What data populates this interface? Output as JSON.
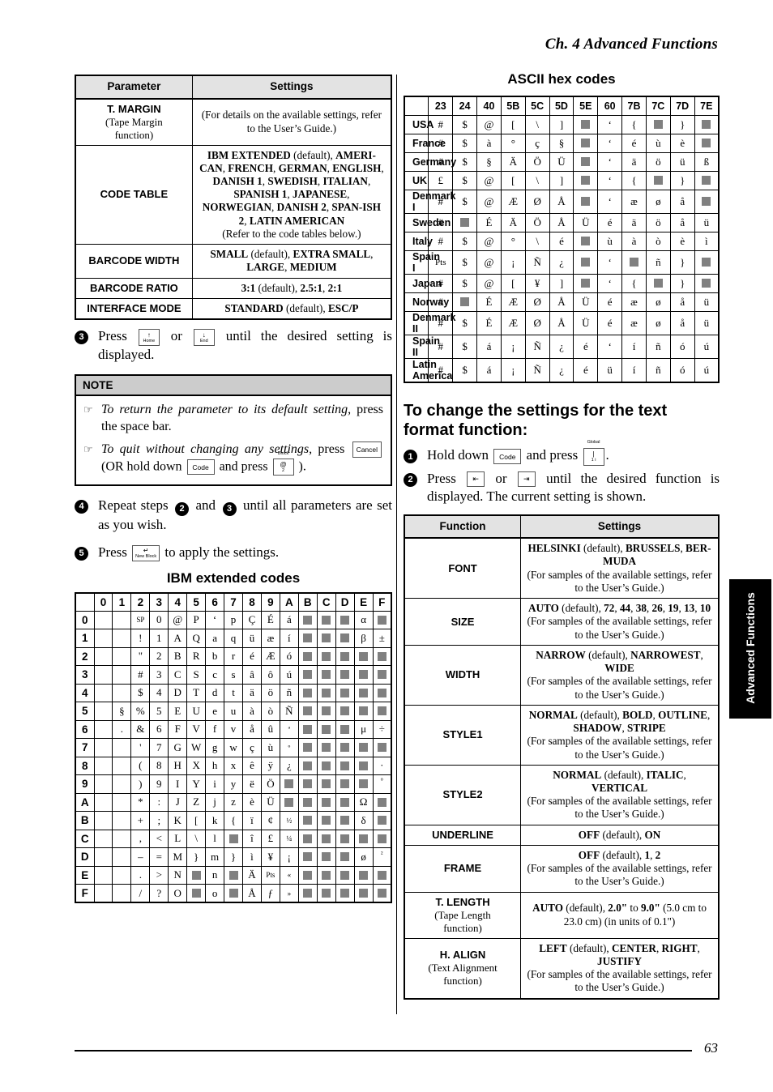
{
  "header": {
    "running_head": "Ch. 4 Advanced Functions"
  },
  "footer": {
    "page_number": "63"
  },
  "side_tab": {
    "label": "Advanced Functions"
  },
  "param_table": {
    "columns": [
      "Parameter",
      "Settings"
    ],
    "rows": [
      {
        "name": "T. MARGIN",
        "sub": "(Tape Margin function)",
        "settings_html": "(For details on the available settings, refer to the User’s Guide.)"
      },
      {
        "name": "CODE TABLE",
        "sub": "",
        "settings_html": "<b>IBM EXTENDED</b> (default), <b>AMERI-CAN</b>, <b>FRENCH</b>, <b>GERMAN</b>, <b>ENGLISH</b>, <b>DANISH 1</b>, <b>SWEDISH</b>, <b>ITALIAN</b>, <b>SPANISH 1</b>, <b>JAPANESE</b>, <b>NORWEGIAN</b>, <b>DANISH 2</b>, <b>SPAN-ISH 2</b>, <b>LATIN AMERICAN</b><br>(Refer to the code tables below.)"
      },
      {
        "name": "BARCODE WIDTH",
        "sub": "",
        "settings_html": "<b>SMALL</b> (default), <b>EXTRA SMALL</b>, <b>LARGE</b>, <b>MEDIUM</b>"
      },
      {
        "name": "BARCODE RATIO",
        "sub": "",
        "settings_html": "<b>3:1</b> (default), <b>2.5:1</b>, <b>2:1</b>"
      },
      {
        "name": "INTERFACE MODE",
        "sub": "",
        "settings_html": "<b>STANDARD</b> (default), <b>ESC/P</b>"
      }
    ]
  },
  "step3": {
    "num": "3",
    "text_before": "Press",
    "key_home": {
      "top": "↑",
      "bottom": "Home"
    },
    "text_or": "or",
    "key_end": {
      "top": "↓",
      "bottom": "End"
    },
    "text_after": "until the desired setting is displayed."
  },
  "note": {
    "title": "NOTE",
    "hand_icon": "☞",
    "item1_html": "<i>To return the parameter to its default setting,</i> press the space bar.",
    "item2_before": "To quit without changing any settings,",
    "item2_press": "press",
    "key_cancel": "Cancel",
    "item2_mid": "(OR hold down",
    "key_code": "Code",
    "item2_and": "and press",
    "key_block": {
      "cap": "Block",
      "top": "@",
      "bottom": "2"
    },
    "item2_end": ")."
  },
  "step4": {
    "num": "4",
    "text_before": "Repeat steps",
    "inline_a": "2",
    "text_and": "and",
    "inline_b": "3",
    "text_after": "until all parameters are set as you wish."
  },
  "step5": {
    "num": "5",
    "text_before": "Press",
    "key_newblock": {
      "top": "↵",
      "bottom": "New Block"
    },
    "text_after": "to apply the settings."
  },
  "ibm_table": {
    "title": "IBM extended codes",
    "columns": [
      "",
      "0",
      "1",
      "2",
      "3",
      "4",
      "5",
      "6",
      "7",
      "8",
      "9",
      "A",
      "B",
      "C",
      "D",
      "E",
      "F"
    ],
    "rows": [
      {
        "label": "0",
        "cells": [
          "",
          "",
          "SP",
          "0",
          "@",
          "P",
          "‘",
          "p",
          "Ç",
          "É",
          "á",
          "■",
          "■",
          "■",
          "α",
          "■"
        ]
      },
      {
        "label": "1",
        "cells": [
          "",
          "",
          "!",
          "1",
          "A",
          "Q",
          "a",
          "q",
          "ü",
          "æ",
          "í",
          "■",
          "■",
          "■",
          "β",
          "±"
        ]
      },
      {
        "label": "2",
        "cells": [
          "",
          "",
          "\"",
          "2",
          "B",
          "R",
          "b",
          "r",
          "é",
          "Æ",
          "ó",
          "■",
          "■",
          "■",
          "■",
          "■"
        ]
      },
      {
        "label": "3",
        "cells": [
          "",
          "",
          "#",
          "3",
          "C",
          "S",
          "c",
          "s",
          "â",
          "ô",
          "ú",
          "■",
          "■",
          "■",
          "■",
          "■"
        ]
      },
      {
        "label": "4",
        "cells": [
          "",
          "",
          "$",
          "4",
          "D",
          "T",
          "d",
          "t",
          "ä",
          "ö",
          "ñ",
          "■",
          "■",
          "■",
          "■",
          "■"
        ]
      },
      {
        "label": "5",
        "cells": [
          "",
          "§",
          "%",
          "5",
          "E",
          "U",
          "e",
          "u",
          "à",
          "ò",
          "Ñ",
          "■",
          "■",
          "■",
          "■",
          "■"
        ]
      },
      {
        "label": "6",
        "cells": [
          "",
          ".",
          "&",
          "6",
          "F",
          "V",
          "f",
          "v",
          "å",
          "û",
          "ª",
          "■",
          "■",
          "■",
          "μ",
          "÷"
        ]
      },
      {
        "label": "7",
        "cells": [
          "",
          "",
          "'",
          "7",
          "G",
          "W",
          "g",
          "w",
          "ç",
          "ù",
          "º",
          "■",
          "■",
          "■",
          "■",
          "■"
        ]
      },
      {
        "label": "8",
        "cells": [
          "",
          "",
          "(",
          "8",
          "H",
          "X",
          "h",
          "x",
          "ê",
          "ÿ",
          "¿",
          "■",
          "■",
          "■",
          "■",
          "·"
        ]
      },
      {
        "label": "9",
        "cells": [
          "",
          "",
          ")",
          "9",
          "I",
          "Y",
          "i",
          "y",
          "ë",
          "Ö",
          "■",
          "■",
          "■",
          "■",
          "■",
          "°"
        ]
      },
      {
        "label": "A",
        "cells": [
          "",
          "",
          "*",
          ":",
          "J",
          "Z",
          "j",
          "z",
          "è",
          "Ü",
          "■",
          "■",
          "■",
          "■",
          "Ω",
          "■"
        ]
      },
      {
        "label": "B",
        "cells": [
          "",
          "",
          "+",
          ";",
          "K",
          "[",
          "k",
          "{",
          "ï",
          "¢",
          "½",
          "■",
          "■",
          "■",
          "δ",
          "■"
        ]
      },
      {
        "label": "C",
        "cells": [
          "",
          "",
          ",",
          "<",
          "L",
          "\\",
          "l",
          "■",
          "î",
          "£",
          "¼",
          "■",
          "■",
          "■",
          "■",
          "■"
        ]
      },
      {
        "label": "D",
        "cells": [
          "",
          "",
          "–",
          "=",
          "M",
          "}",
          "m",
          "}",
          "ì",
          "¥",
          "¡",
          "■",
          "■",
          "■",
          "ø",
          "²"
        ]
      },
      {
        "label": "E",
        "cells": [
          "",
          "",
          ".",
          ">",
          "N",
          "■",
          "n",
          "■",
          "Ä",
          "Pts",
          "«",
          "■",
          "■",
          "■",
          "■",
          "■"
        ]
      },
      {
        "label": "F",
        "cells": [
          "",
          "",
          "/",
          "?",
          "O",
          "■",
          "o",
          "■",
          "Å",
          "ƒ",
          "»",
          "■",
          "■",
          "■",
          "■",
          "■"
        ]
      }
    ]
  },
  "ascii_table": {
    "title": "ASCII hex codes",
    "columns": [
      "",
      "23",
      "24",
      "40",
      "5B",
      "5C",
      "5D",
      "5E",
      "60",
      "7B",
      "7C",
      "7D",
      "7E"
    ],
    "rows": [
      {
        "label": "USA",
        "cells": [
          "#",
          "$",
          "@",
          "[",
          "\\",
          "]",
          "■",
          "‘",
          "{",
          "■",
          "}",
          "■"
        ]
      },
      {
        "label": "France",
        "cells": [
          "#",
          "$",
          "à",
          "°",
          "ç",
          "§",
          "■",
          "‘",
          "é",
          "ù",
          "è",
          "■"
        ]
      },
      {
        "label": "Germany",
        "cells": [
          "#",
          "$",
          "§",
          "Ä",
          "Ö",
          "Ü",
          "■",
          "‘",
          "ä",
          "ö",
          "ü",
          "ß"
        ]
      },
      {
        "label": "UK",
        "cells": [
          "£",
          "$",
          "@",
          "[",
          "\\",
          "]",
          "■",
          "‘",
          "{",
          "■",
          "}",
          "■"
        ]
      },
      {
        "label": "Denmark I",
        "cells": [
          "#",
          "$",
          "@",
          "Æ",
          "Ø",
          "Å",
          "■",
          "‘",
          "æ",
          "ø",
          "å",
          "■"
        ]
      },
      {
        "label": "Sweden",
        "cells": [
          "#",
          "■",
          "É",
          "Ä",
          "Ö",
          "Å",
          "Ü",
          "é",
          "ä",
          "ö",
          "å",
          "ü"
        ]
      },
      {
        "label": "Italy",
        "cells": [
          "#",
          "$",
          "@",
          "°",
          "\\",
          "é",
          "■",
          "ù",
          "à",
          "ò",
          "è",
          "ì"
        ]
      },
      {
        "label": "Spain I",
        "cells": [
          "Pts",
          "$",
          "@",
          "¡",
          "Ñ",
          "¿",
          "■",
          "‘",
          "■",
          "ñ",
          "}",
          "■"
        ]
      },
      {
        "label": "Japan",
        "cells": [
          "#",
          "$",
          "@",
          "[",
          "¥",
          "]",
          "■",
          "‘",
          "{",
          "■",
          "}",
          "■"
        ]
      },
      {
        "label": "Norway",
        "cells": [
          "#",
          "■",
          "É",
          "Æ",
          "Ø",
          "Å",
          "Ü",
          "é",
          "æ",
          "ø",
          "å",
          "ü"
        ]
      },
      {
        "label": "Denmark II",
        "cells": [
          "#",
          "$",
          "É",
          "Æ",
          "Ø",
          "Å",
          "Ü",
          "é",
          "æ",
          "ø",
          "å",
          "ü"
        ]
      },
      {
        "label": "Spain II",
        "cells": [
          "#",
          "$",
          "á",
          "¡",
          "Ñ",
          "¿",
          "é",
          "‘",
          "í",
          "ñ",
          "ó",
          "ú"
        ]
      },
      {
        "label": "Latin America",
        "cells": [
          "#",
          "$",
          "á",
          "¡",
          "Ñ",
          "¿",
          "é",
          "ü",
          "í",
          "ñ",
          "ó",
          "ú"
        ]
      }
    ]
  },
  "textformat": {
    "heading": "To change the settings for the text format function:",
    "step1": {
      "num": "1",
      "text_before": "Hold down",
      "key_code": "Code",
      "text_mid": "and press",
      "key_global": {
        "cap": "Global",
        "top": "|",
        "bottom": "1  i"
      },
      "text_after": "."
    },
    "step2": {
      "num": "2",
      "text_before": "Press",
      "key_left": "⇤",
      "text_or": "or",
      "key_right": "⇥",
      "text_after": "until the desired function is displayed. The current setting is shown."
    }
  },
  "function_table": {
    "columns": [
      "Function",
      "Settings"
    ],
    "rows": [
      {
        "name": "FONT",
        "sub": "",
        "settings_html": "<b>HELSINKI</b> (default), <b>BRUSSELS</b>, <b>BER-MUDA</b><br>(For samples of the available settings, refer to the User’s Guide.)"
      },
      {
        "name": "SIZE",
        "sub": "",
        "settings_html": "<b>AUTO</b> (default), <b>72</b>, <b>44</b>, <b>38</b>, <b>26</b>, <b>19</b>, <b>13</b>, <b>10</b><br>(For samples of the available settings, refer to the User’s Guide.)"
      },
      {
        "name": "WIDTH",
        "sub": "",
        "settings_html": "<b>NARROW</b> (default), <b>NARROWEST</b>, <b>WIDE</b><br>(For samples of the available settings, refer to the User’s Guide.)"
      },
      {
        "name": "STYLE1",
        "sub": "",
        "settings_html": "<b>NORMAL</b> (default), <b>BOLD</b>, <b>OUTLINE</b>, <b>SHADOW</b>, <b>STRIPE</b><br>(For samples of the available settings, refer to the User’s Guide.)"
      },
      {
        "name": "STYLE2",
        "sub": "",
        "settings_html": "<b>NORMAL</b> (default), <b>ITALIC</b>, <b>VERTICAL</b><br>(For samples of the available settings, refer to the User’s Guide.)"
      },
      {
        "name": "UNDERLINE",
        "sub": "",
        "settings_html": "<b>OFF</b> (default), <b>ON</b>"
      },
      {
        "name": "FRAME",
        "sub": "",
        "settings_html": "<b>OFF</b> (default), <b>1</b>, <b>2</b><br>(For samples of the available settings, refer to the User’s Guide.)"
      },
      {
        "name": "T. LENGTH",
        "sub": "(Tape Length function)",
        "settings_html": "<b>AUTO</b> (default), <b>2.0\"</b> to <b>9.0\"</b> (5.0 cm to 23.0 cm) (in units of 0.1\")"
      },
      {
        "name": "H. ALIGN",
        "sub": "(Text Alignment function)",
        "settings_html": "<b>LEFT</b> (default), <b>CENTER</b>, <b>RIGHT</b>, <b>JUSTIFY</b><br>(For samples of the available settings, refer to the User’s Guide.)"
      }
    ]
  }
}
